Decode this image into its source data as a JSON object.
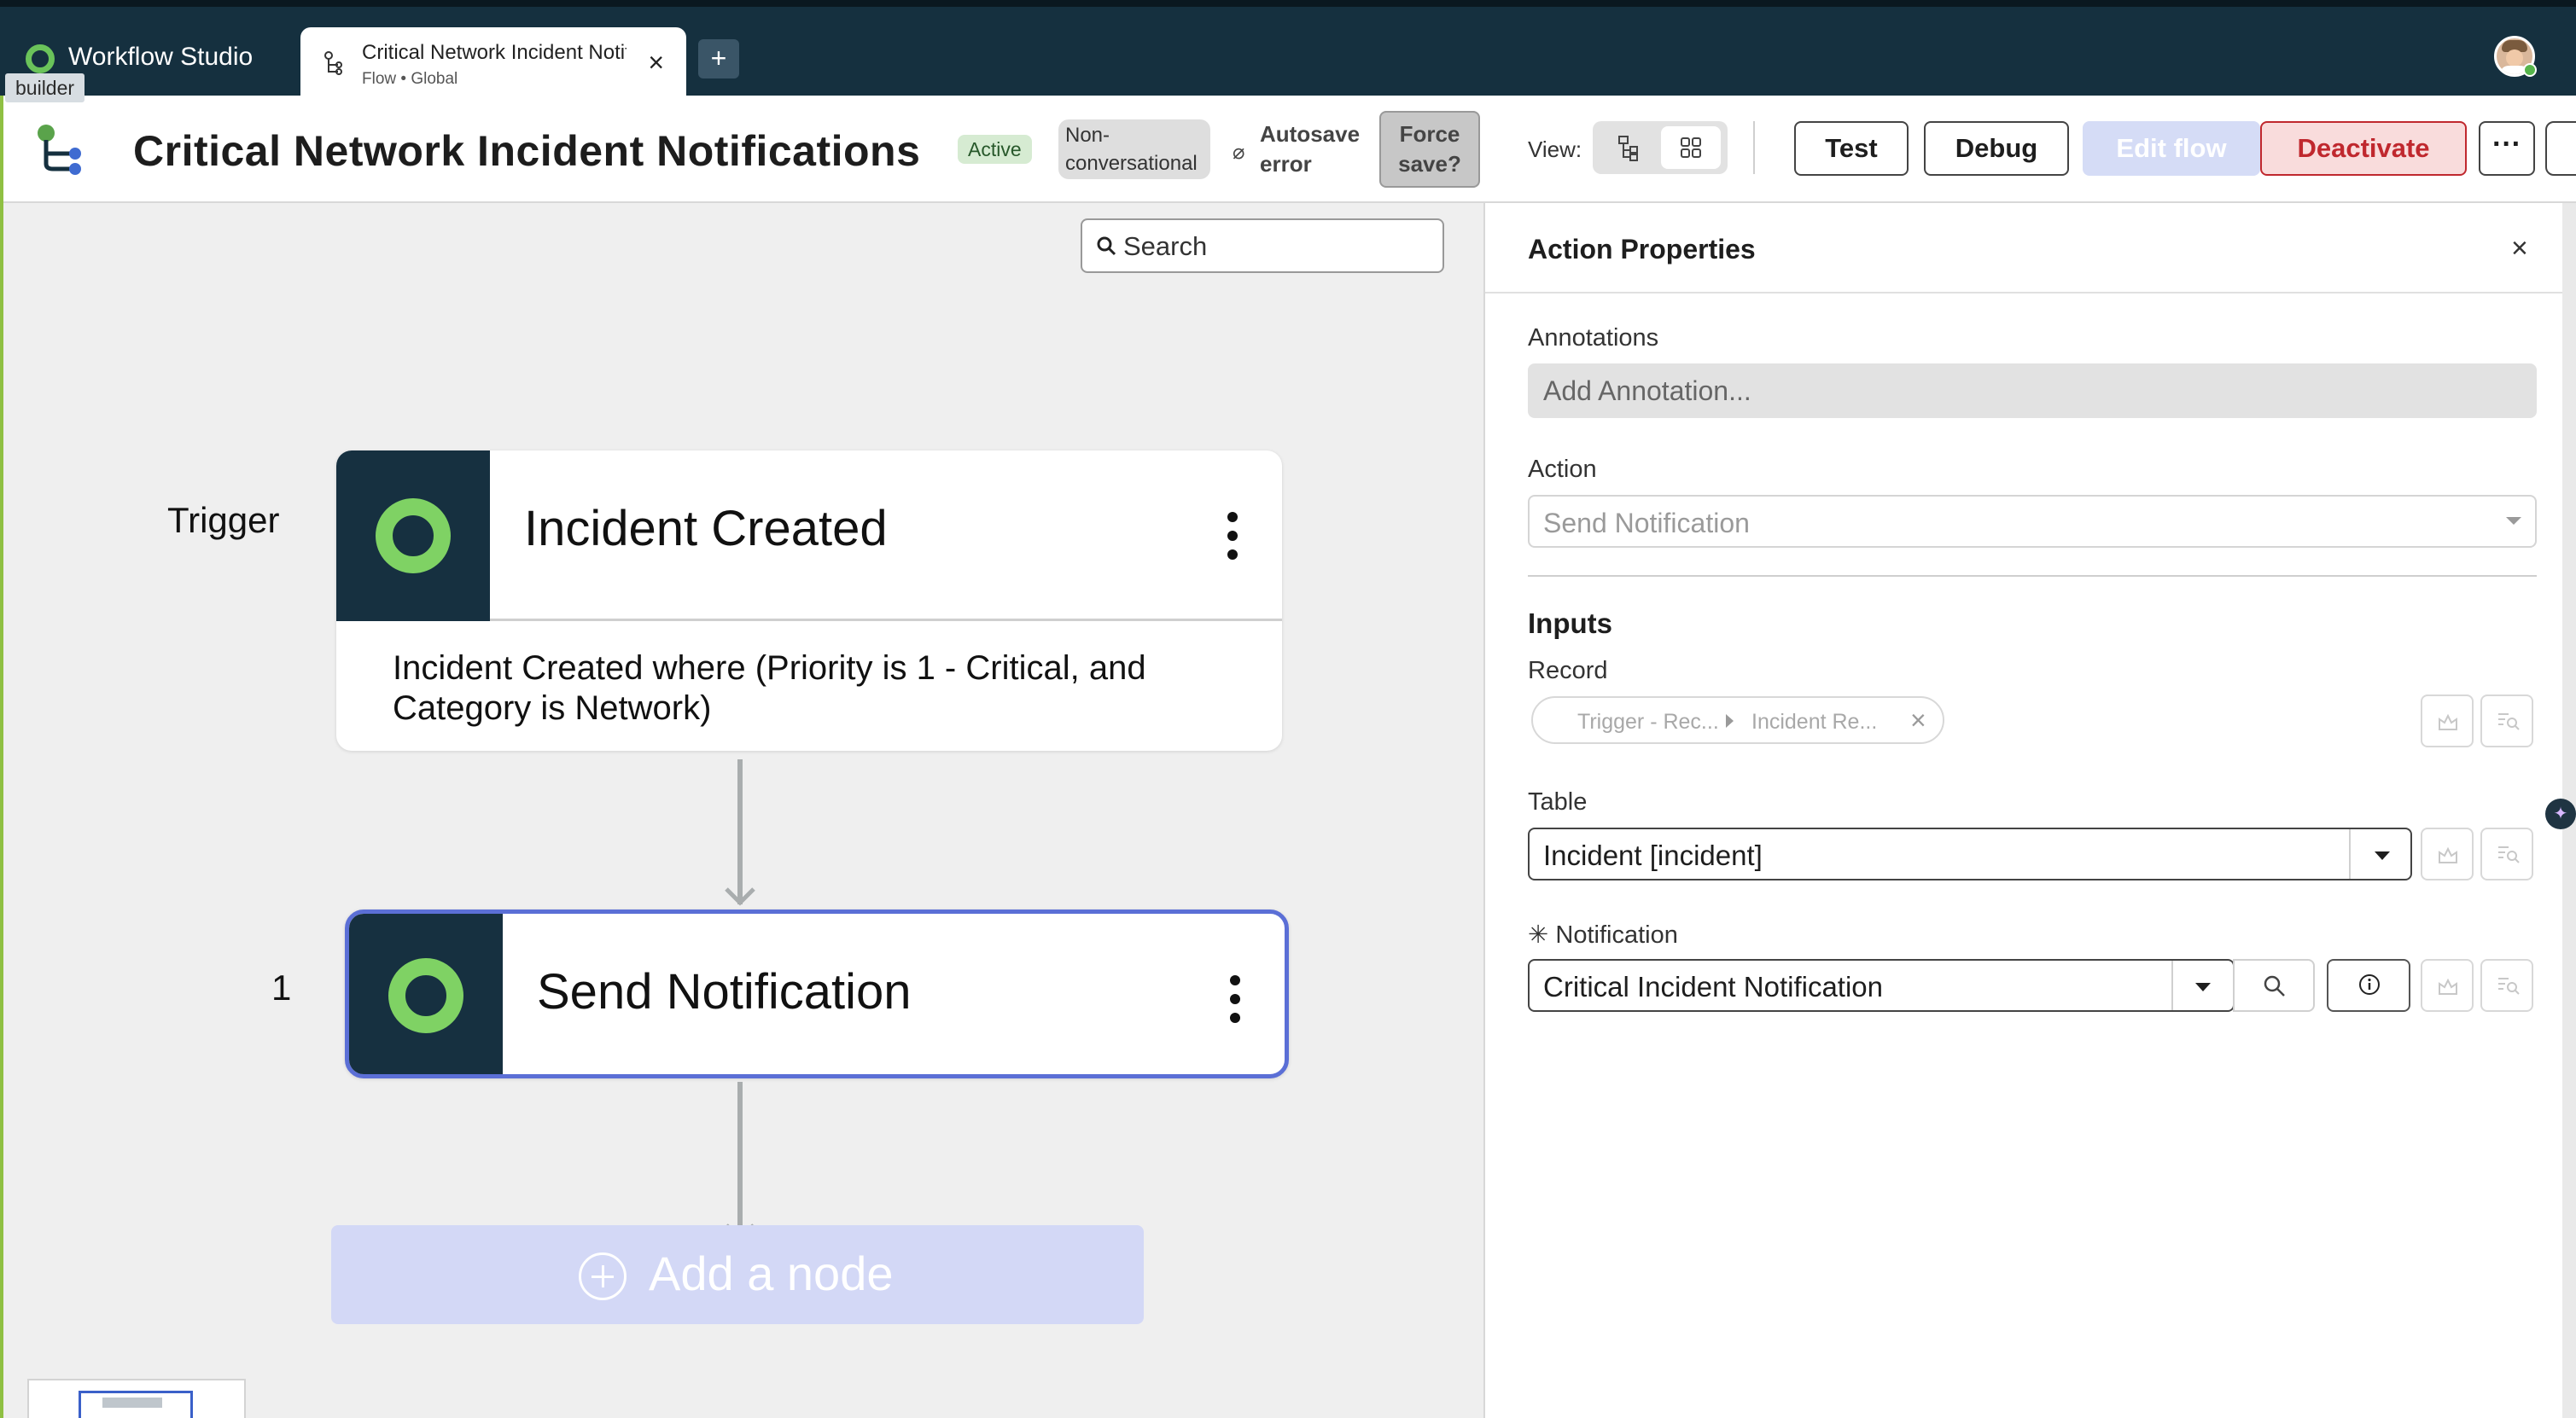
{
  "app": {
    "name": "Workflow Studio",
    "tooltip": "builder",
    "tab": {
      "title": "Critical Network Incident Notifications",
      "subtitle": "Flow • Global"
    }
  },
  "header": {
    "title": "Critical Network Incident Notifications",
    "status_badge": "Active",
    "mode_badge": "Non-conversational",
    "autosave_text": "Autosave error",
    "force_save_label": "Force save?",
    "view_label": "View:",
    "buttons": {
      "test": "Test",
      "debug": "Debug",
      "edit_flow": "Edit flow",
      "deactivate": "Deactivate",
      "more": "···"
    }
  },
  "canvas": {
    "search_placeholder": "Search",
    "trigger": {
      "step_label": "Trigger",
      "title": "Incident Created",
      "condition": "Incident Created where (Priority is 1 - Critical, and Category is Network)"
    },
    "action": {
      "step_label": "1",
      "title": "Send Notification"
    },
    "add_node_label": "Add a node"
  },
  "panel": {
    "title": "Action Properties",
    "annotations_label": "Annotations",
    "annotations_placeholder": "Add Annotation...",
    "action_label": "Action",
    "action_value": "Send Notification",
    "inputs_title": "Inputs",
    "record_label": "Record",
    "record_pill": {
      "segment1": "Trigger - Rec...",
      "segment2": "Incident Re..."
    },
    "table_label": "Table",
    "table_value": "Incident [incident]",
    "notification_label": "Notification",
    "notification_required_mark": "✳",
    "notification_value": "Critical Incident Notification"
  },
  "colors": {
    "top_bar": "#15303f",
    "accent_green": "#7fd264",
    "selected_border": "#5b6fd6",
    "danger": "#c0282e",
    "frame_green": "#8fc043"
  },
  "icons": [
    "workflow-logo-icon",
    "flow-tab-icon",
    "close-icon",
    "plus-icon",
    "search-icon",
    "kebab-icon",
    "chevron-down-icon",
    "info-icon",
    "data-pill-icon",
    "clear-icon",
    "sparkle-icon"
  ]
}
